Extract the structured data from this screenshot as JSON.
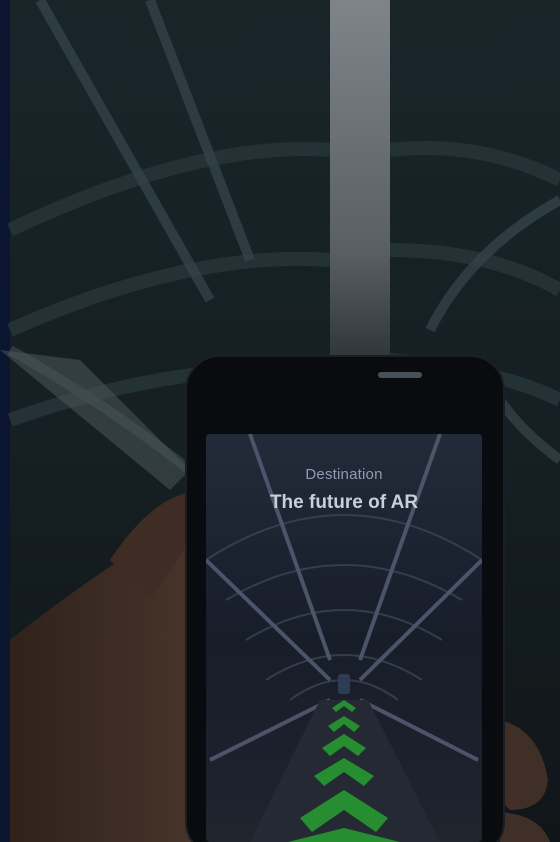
{
  "phone_screen": {
    "label": "Destination",
    "title": "The future of AR"
  }
}
